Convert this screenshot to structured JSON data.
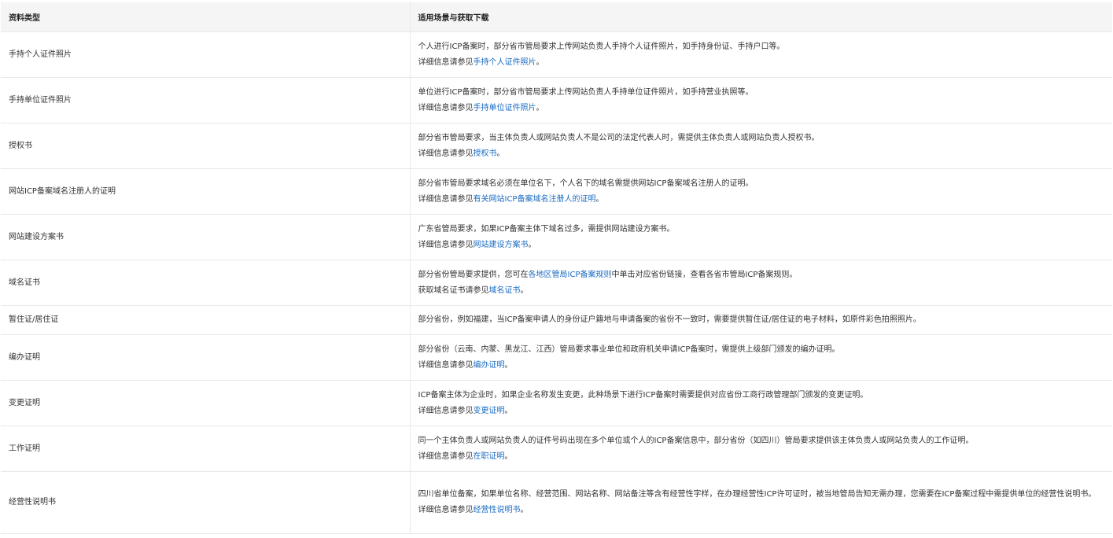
{
  "header": {
    "col1": "资料类型",
    "col2": "适用场景与获取下载"
  },
  "rows": [
    {
      "type": "手持个人证件照片",
      "line1": {
        "text": "个人进行ICP备案时，部分省市管局要求上传网站负责人手持个人证件照片，如手持身份证、手持户口等。"
      },
      "line2": {
        "pre": "详细信息请参见",
        "link": "手持个人证件照片",
        "post": "。"
      }
    },
    {
      "type": "手持单位证件照片",
      "line1": {
        "text": "单位进行ICP备案时，部分省市管局要求上传网站负责人手持单位证件照片，如手持营业执照等。"
      },
      "line2": {
        "pre": "详细信息请参见",
        "link": "手持单位证件照片",
        "post": "。"
      }
    },
    {
      "type": "授权书",
      "line1": {
        "text": "部分省市管局要求，当主体负责人或网站负责人不是公司的法定代表人时，需提供主体负责人或网站负责人授权书。"
      },
      "line2": {
        "pre": "详细信息请参见",
        "link": "授权书",
        "post": "。"
      }
    },
    {
      "type": "网站ICP备案域名注册人的证明",
      "line1": {
        "text": "部分省市管局要求域名必须在单位名下，个人名下的域名需提供网站ICP备案域名注册人的证明。"
      },
      "line2": {
        "pre": "详细信息请参见",
        "link": "有关网站ICP备案域名注册人的证明",
        "post": "。"
      }
    },
    {
      "type": "网站建设方案书",
      "line1": {
        "text": "广东省管局要求，如果ICP备案主体下域名过多，需提供网站建设方案书。"
      },
      "line2": {
        "pre": "详细信息请参见",
        "link": "网站建设方案书",
        "post": "。"
      }
    },
    {
      "type": "域名证书",
      "line1": {
        "pre": "部分省份管局要求提供，您可在",
        "link": "各地区管局ICP备案规则",
        "post": "中单击对应省份链接，查看各省市管局ICP备案规则。"
      },
      "line2": {
        "pre": "获取域名证书请参见",
        "link": "域名证书",
        "post": "。"
      }
    },
    {
      "type": "暂住证/居住证",
      "line1": {
        "text": "部分省份，例如福建，当ICP备案申请人的身份证户籍地与申请备案的省份不一致时，需要提供暂住证/居住证的电子材料，如原件彩色拍照照片。"
      }
    },
    {
      "type": "编办证明",
      "line1": {
        "text": "部分省份（云南、内蒙、黑龙江、江西）管局要求事业单位和政府机关申请ICP备案时，需提供上级部门颁发的编办证明。"
      },
      "line2": {
        "pre": "详细信息请参见",
        "link": "编办证明",
        "post": "。"
      }
    },
    {
      "type": "变更证明",
      "line1": {
        "text": "ICP备案主体为企业时，如果企业名称发生变更，此种场景下进行ICP备案时需要提供对应省份工商行政管理部门颁发的变更证明。"
      },
      "line2": {
        "pre": "详细信息请参见",
        "link": "变更证明",
        "post": "。"
      }
    },
    {
      "type": "工作证明",
      "line1": {
        "text": "同一个主体负责人或网站负责人的证件号码出现在多个单位或个人的ICP备案信息中，部分省份（如四川）管局要求提供该主体负责人或网站负责人的工作证明。"
      },
      "line2": {
        "pre": "详细信息请参见",
        "link": "在职证明",
        "post": "。"
      }
    },
    {
      "type": "经营性说明书",
      "line1": {
        "text": "四川省单位备案，如果单位名称、经营范围、网站名称、网站备注等含有经营性字样，在办理经营性ICP许可证时，被当地管局告知无需办理，您需要在ICP备案过程中需提供单位的经营性说明书。"
      },
      "line2": {
        "pre": "详细信息请参见",
        "link": "经营性说明书",
        "post": "。"
      }
    }
  ]
}
